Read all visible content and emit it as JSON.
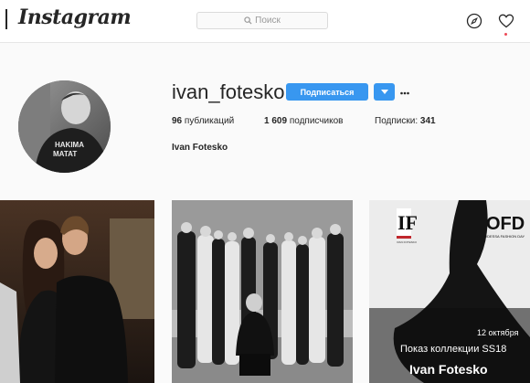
{
  "header": {
    "logo_text": "Instagram",
    "search_placeholder": "Поиск",
    "icons": [
      "compass-icon",
      "heart-icon"
    ],
    "notification_color": "#ed4956"
  },
  "profile": {
    "username": "ivan_fotesko",
    "follow_label": "Подписаться",
    "stats": {
      "posts_count": "96",
      "posts_label": "публикаций",
      "followers_count": "1 609",
      "followers_label": "подписчиков",
      "following_label": "Подписки:",
      "following_count": "341"
    },
    "full_name": "Ivan Fotesko",
    "avatar_shirt_text": [
      "HAKIMA",
      "MATAT"
    ],
    "accent_color": "#3897f0"
  },
  "posts": [
    {
      "kind": "photo",
      "description_icon": "couple-photo"
    },
    {
      "kind": "photo",
      "description_icon": "runway-group-photo"
    },
    {
      "kind": "poster",
      "logo_left": "IF",
      "logo_left_caption": "IVAN FOTESKO",
      "logo_right": "OFD",
      "logo_right_caption": "ODESSA FASHION DAY",
      "date": "12 октября",
      "title": "Показ коллекции SS18",
      "name": "Ivan Fotesko"
    }
  ]
}
